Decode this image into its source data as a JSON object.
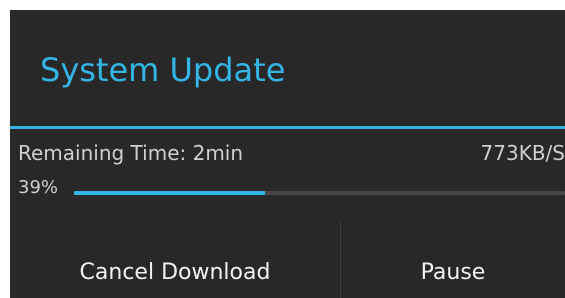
{
  "dialog": {
    "title": "System Update",
    "remaining_time": "Remaining Time: 2min",
    "speed": "773KB/S",
    "progress_label": "39%",
    "progress_fraction": 0.39,
    "accent_color": "#33b5e5",
    "background_color": "#282828"
  },
  "buttons": {
    "cancel_label": "Cancel Download",
    "pause_label": "Pause"
  }
}
